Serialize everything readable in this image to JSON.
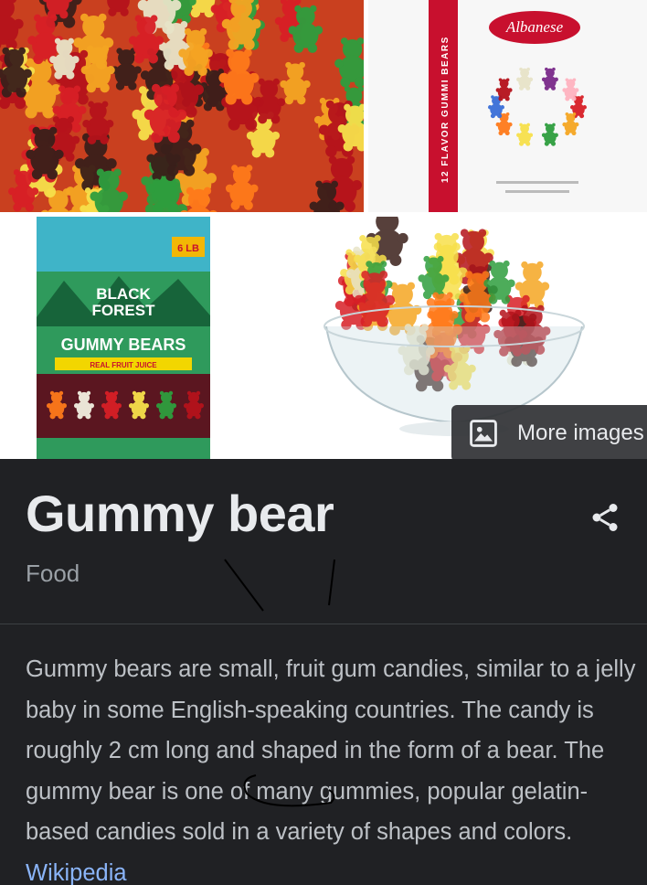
{
  "gallery": {
    "more_images_label": "More images",
    "bag_brand": "Albanese",
    "bag_side_text": "12 FLAVOR GUMMI BEARS",
    "bf_brand_top": "BLACK",
    "bf_brand_bottom": "FOREST",
    "bf_product": "GUMMY BEARS",
    "bf_tagline": "REAL FRUIT JUICE",
    "bf_badge": "6 LB"
  },
  "entity": {
    "title": "Gummy bear",
    "category": "Food",
    "description": "Gummy bears are small, fruit gum candies, similar to a jelly baby in some English-speaking countries. The candy is roughly 2 cm long and shaped in the form of a bear. The gummy bear is one of many gummies, popular gelatin-based candies sold in a variety of shapes and colors.",
    "source_link": "Wikipedia"
  },
  "colors": {
    "panel_bg": "#202124",
    "title": "#e8eaed",
    "text": "#bdc1c6",
    "muted": "#9aa0a6",
    "link": "#8ab4f8"
  },
  "icons": {
    "more_images": "image-icon",
    "share": "share-icon"
  }
}
